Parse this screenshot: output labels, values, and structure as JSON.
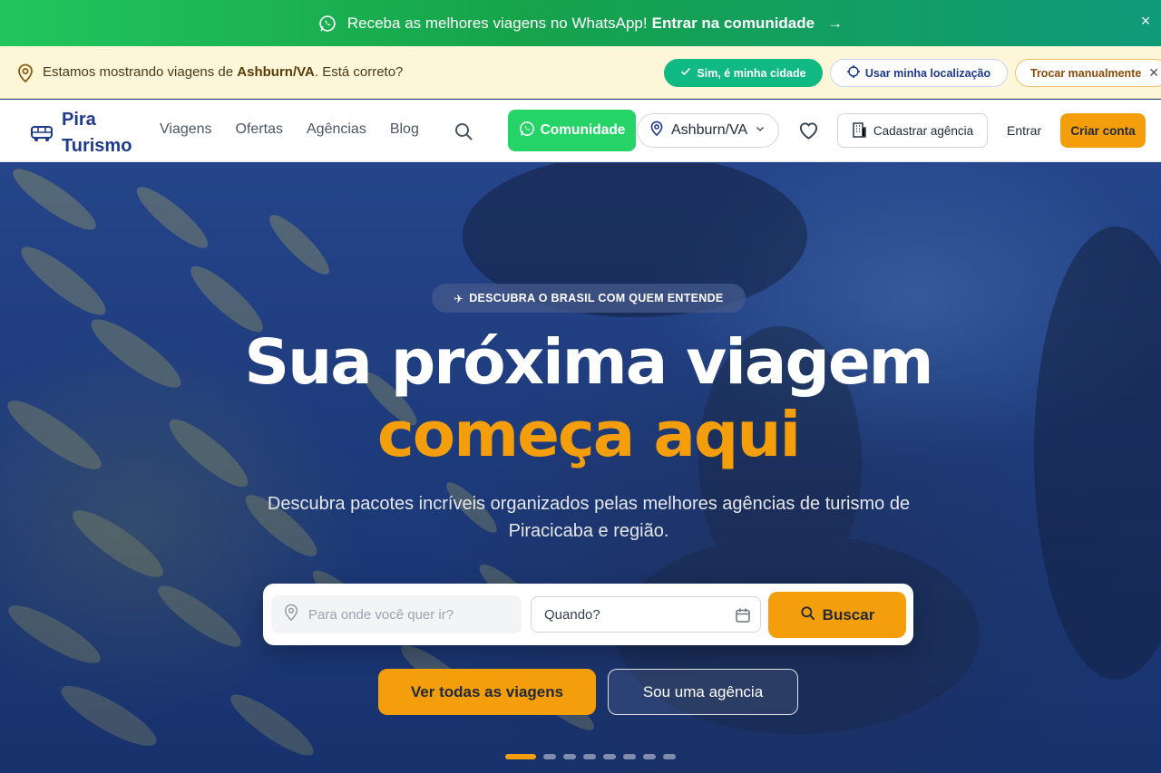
{
  "promo": {
    "text": "Receba as melhores viagens no WhatsApp!",
    "cta": "Entrar na comunidade",
    "arrow": "→",
    "close": "×"
  },
  "location_bar": {
    "prefix": "Estamos mostrando viagens de",
    "city": "Ashburn/VA",
    "suffix": ". Está correto?",
    "confirm": "Sim, é minha cidade",
    "use_location": "Usar minha localização",
    "manual": "Trocar manualmente",
    "manual_close": "✕"
  },
  "header": {
    "logo_line1": "Pira",
    "logo_line2": "Turismo",
    "nav": [
      "Viagens",
      "Ofertas",
      "Agências",
      "Blog"
    ],
    "community": "Comunidade",
    "location": "Ashburn/VA",
    "register_agency": "Cadastrar agência",
    "login": "Entrar",
    "signup": "Criar conta"
  },
  "hero": {
    "badge_icon": "✈",
    "badge": "DESCUBRA O BRASIL COM QUEM ENTENDE",
    "title_line1": "Sua próxima viagem",
    "title_line2": "começa aqui",
    "subtitle": "Descubra pacotes incríveis organizados pelas melhores agências de turismo de Piracicaba e região.",
    "search_placeholder": "Para onde você quer ir?",
    "date_placeholder": "Quando?",
    "search_button": "Buscar",
    "all_trips": "Ver todas as viagens",
    "agency": "Sou uma agência",
    "slides": 8,
    "active_slide": 1
  },
  "colors": {
    "whatsapp_green": "#25d366",
    "accent_orange": "#f59e0b",
    "brand_blue": "#1e3a8a"
  }
}
